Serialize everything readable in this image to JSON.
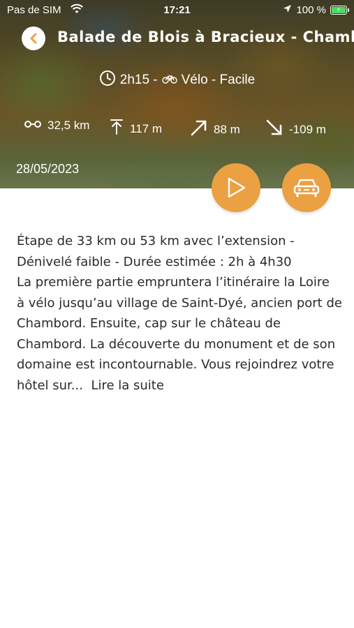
{
  "status_bar": {
    "carrier": "Pas de SIM",
    "time": "17:21",
    "battery": "100 %"
  },
  "hike": {
    "title": "Balade de Blois à Bracieux - Chambord",
    "duration_line": "2h15 -",
    "activity_line": "Vélo - Facile",
    "date": "28/05/2023",
    "stats": {
      "distance": "32,5 km",
      "max_altitude": "117 m",
      "ascent": "88 m",
      "descent": "-109 m"
    }
  },
  "description": {
    "lines": [
      "Étape de 33 km ou 53 km avec l’extension -",
      "Dénivelé faible - Durée estimée : 2h à 4h30",
      "La première partie empruntera l’itinéraire la Loire",
      "à vélo jusqu’au village de Saint-Dyé, ancien port de",
      "Chambord. Ensuite, cap sur le château de",
      "Chambord. La découverte du monument et de son",
      "domaine est incontournable. Vous rejoindrez votre",
      "hôtel sur..."
    ],
    "read_more": "Lire la suite"
  },
  "icons": {
    "back": "chevron-left-icon",
    "play": "play-icon",
    "car": "car-icon"
  },
  "colors": {
    "accent": "#eba042",
    "battery": "#4cd964",
    "text": "#2b2b2b"
  }
}
